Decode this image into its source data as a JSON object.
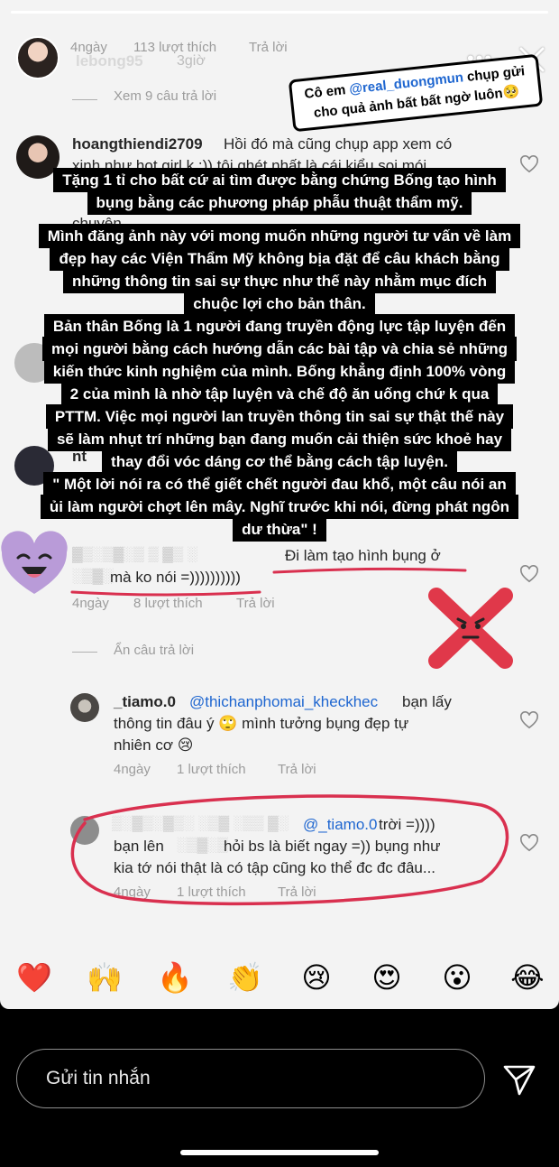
{
  "header": {
    "username": "lebong95",
    "time": "3giờ",
    "progress": 1.0
  },
  "top_comment_meta": {
    "age": "4ngày",
    "likes": "113 lượt thích",
    "reply": "Trả lời"
  },
  "view_replies": "Xem 9 câu trả lời",
  "comment1": {
    "username": "hoangthiendi2709",
    "text_line1": "Hồi đó mà cũng chụp app xem có",
    "text_line2": "xinh như hot girl k :)) tôi ghét nhất là cái kiểu soi mói",
    "text_line3": "chuyện"
  },
  "sticker_top": {
    "prefix": "Cô em ",
    "mention": "@real_duongmun",
    "line1_suffix": " chụp gửi",
    "line2": "cho quả ảnh bất bất ngờ luôn🥺"
  },
  "statement": {
    "p1": [
      "Tặng 1 tỉ cho bất cứ ai tìm được bằng chứng Bống tạo hình",
      "bụng bằng các phương pháp phẫu thuật thẩm mỹ."
    ],
    "p2": [
      "Mình đăng ảnh này với mong muốn những người tư vấn về làm",
      "đẹp hay các Viện Thẩm Mỹ không bịa đặt để câu khách bằng",
      "những thông tin sai sự thực như thế này nhằm mục đích",
      "chuộc lợi cho bản thân."
    ],
    "p3": [
      "Bản thân Bống là 1 người đang truyền động lực tập luyện đến",
      "mọi người bằng cách hướng dẫn các bài tập và chia sẻ những",
      "kiến thức kinh nghiệm của mình. Bống khẳng định 100% vòng",
      "2 của mình là nhờ tập luyện và chế độ ăn uống chứ k qua",
      "PTTM. Việc mọi người lan truyền thông tin sai sự thật thế này",
      "sẽ làm nhụt trí những bạn đang muốn cải thiện sức khoẻ hay",
      "thay đổi vóc dáng cơ thể bằng cách tập luyện."
    ],
    "p4": [
      "\" Một lời nói ra có thể giết chết người đau khổ, một câu nói an",
      "ủi làm người chợt lên mây. Nghĩ trước khi nói, đừng phát ngôn",
      "dư thừa\" !"
    ]
  },
  "comment2": {
    "text_line1": "Đi làm tạo hình bụng ở",
    "text_line2": "mà ko nói =))))))))))",
    "age": "4ngày",
    "likes": "8 lượt thích",
    "reply": "Trả lời"
  },
  "hide_replies": "Ẩn câu trả lời",
  "reply1": {
    "username": "_tiamo.0",
    "mention": "@thichanphomai_kheckhec",
    "text_after": " bạn lấy",
    "line2": "thông tin đâu ý 🙄 mình tưởng bụng đẹp tự",
    "line3": "nhiên cơ 😢",
    "age": "4ngày",
    "likes": "1 lượt thích",
    "reply": "Trả lời"
  },
  "reply2": {
    "mention": "@_tiamo.0",
    "text_after": " trời =))))",
    "line2_a": "bạn lên",
    "line2_b": "hỏi bs là biết ngay =)) bụng như",
    "line3": "kia tớ nói thật là có tập cũng ko thể đc đc đâu...",
    "age": "4ngày",
    "likes": "1 lượt thích",
    "reply": "Trả lời"
  },
  "reactions": [
    "❤️",
    "🙌",
    "🔥",
    "👏",
    "😢",
    "😍",
    "😮",
    "😂"
  ],
  "message": {
    "placeholder": "Gửi tin nhắn"
  },
  "colors": {
    "accent_red": "#d9304f",
    "mention_blue": "#1e66d0",
    "x_red": "#e0384a"
  }
}
